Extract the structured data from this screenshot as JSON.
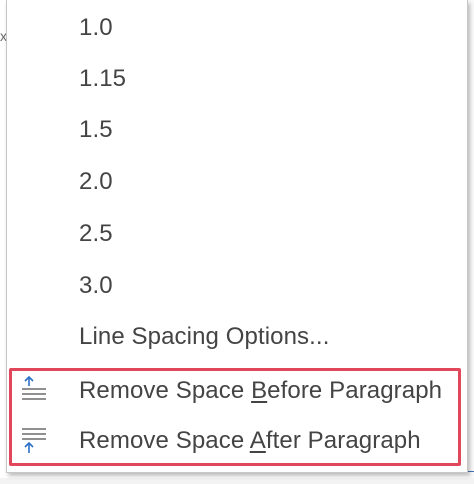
{
  "menu": {
    "spacing_options": [
      "1.0",
      "1.15",
      "1.5",
      "2.0",
      "2.5",
      "3.0"
    ],
    "options_label": "Line Spacing Options...",
    "remove_before": {
      "prefix": "Remove Space ",
      "accel": "B",
      "suffix": "efore Paragraph",
      "icon": "space-before-icon"
    },
    "remove_after": {
      "prefix": "Remove Space ",
      "accel": "A",
      "suffix": "fter Paragraph",
      "icon": "space-after-icon"
    }
  },
  "colors": {
    "highlight_border": "#e0475b",
    "icon_arrow": "#2b6fc6",
    "text": "#444444"
  }
}
